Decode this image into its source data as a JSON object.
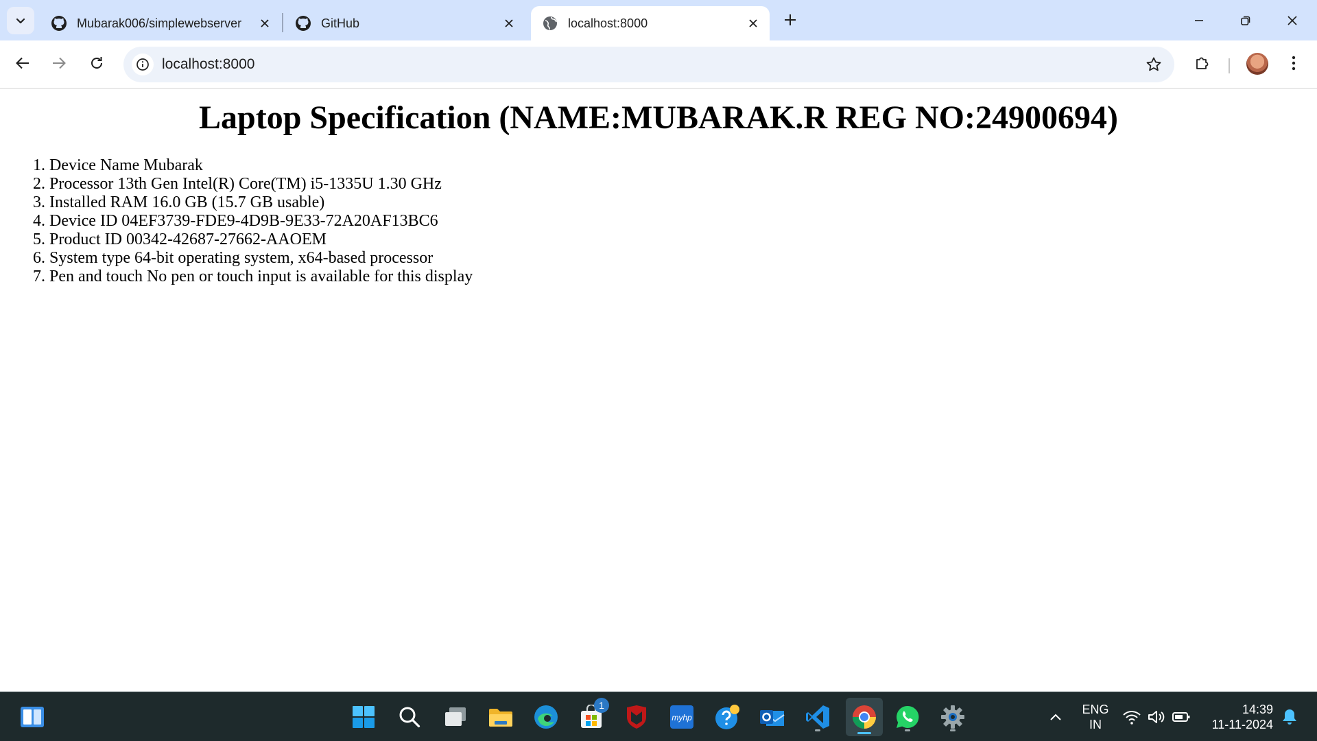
{
  "browser": {
    "tabs": [
      {
        "title": "Mubarak006/simplewebserver",
        "icon": "github-icon"
      },
      {
        "title": "GitHub",
        "icon": "github-icon"
      },
      {
        "title": "localhost:8000",
        "icon": "globe-icon",
        "active": true
      }
    ],
    "address": "localhost:8000"
  },
  "page": {
    "heading": "Laptop Specification (NAME:MUBARAK.R REG NO:24900694)",
    "items": [
      "Device Name Mubarak",
      "Processor 13th Gen Intel(R) Core(TM) i5-1335U 1.30 GHz",
      "Installed RAM 16.0 GB (15.7 GB usable)",
      "Device ID 04EF3739-FDE9-4D9B-9E33-72A20AF13BC6",
      "Product ID 00342-42687-27662-AAOEM",
      "System type 64-bit operating system, x64-based processor",
      "Pen and touch No pen or touch input is available for this display"
    ]
  },
  "taskbar": {
    "store_badge": "1",
    "myhp_label": "myhp",
    "language": "ENG",
    "region": "IN",
    "time": "14:39",
    "date": "11-11-2024"
  },
  "colors": {
    "tabstrip": "#d3e3fd",
    "omnibox": "#edf2fa",
    "taskbar": "#1e2a2c",
    "accent": "#4cc2ff"
  }
}
